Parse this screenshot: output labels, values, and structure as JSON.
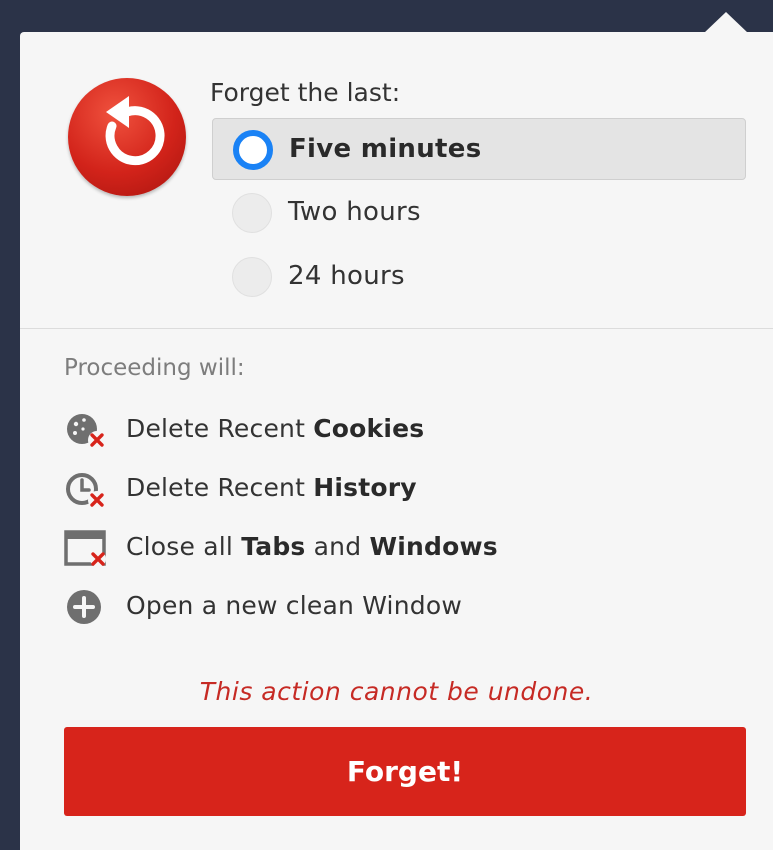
{
  "forget_label": "Forget the last:",
  "options": [
    {
      "label": "Five minutes",
      "selected": true
    },
    {
      "label": "Two hours",
      "selected": false
    },
    {
      "label": "24 hours",
      "selected": false
    }
  ],
  "proceed": {
    "title": "Proceeding will:",
    "items": [
      {
        "icon": "delete-cookies-icon",
        "prefix": "Delete Recent ",
        "bold1": "Cookies",
        "middle": "",
        "bold2": ""
      },
      {
        "icon": "delete-history-icon",
        "prefix": "Delete Recent ",
        "bold1": "History",
        "middle": "",
        "bold2": ""
      },
      {
        "icon": "close-windows-icon",
        "prefix": "Close all ",
        "bold1": "Tabs",
        "middle": " and ",
        "bold2": "Windows"
      },
      {
        "icon": "plus-circle-icon",
        "prefix": "Open a new clean Window",
        "bold1": "",
        "middle": "",
        "bold2": ""
      }
    ]
  },
  "warning": "This action cannot be undone.",
  "button_label": "Forget!",
  "colors": {
    "accent_red": "#d7241b",
    "radio_blue": "#1a82f5",
    "warning_red": "#c62a24",
    "backdrop": "#2b3348"
  },
  "logo_icon": "undo-arrow-icon"
}
